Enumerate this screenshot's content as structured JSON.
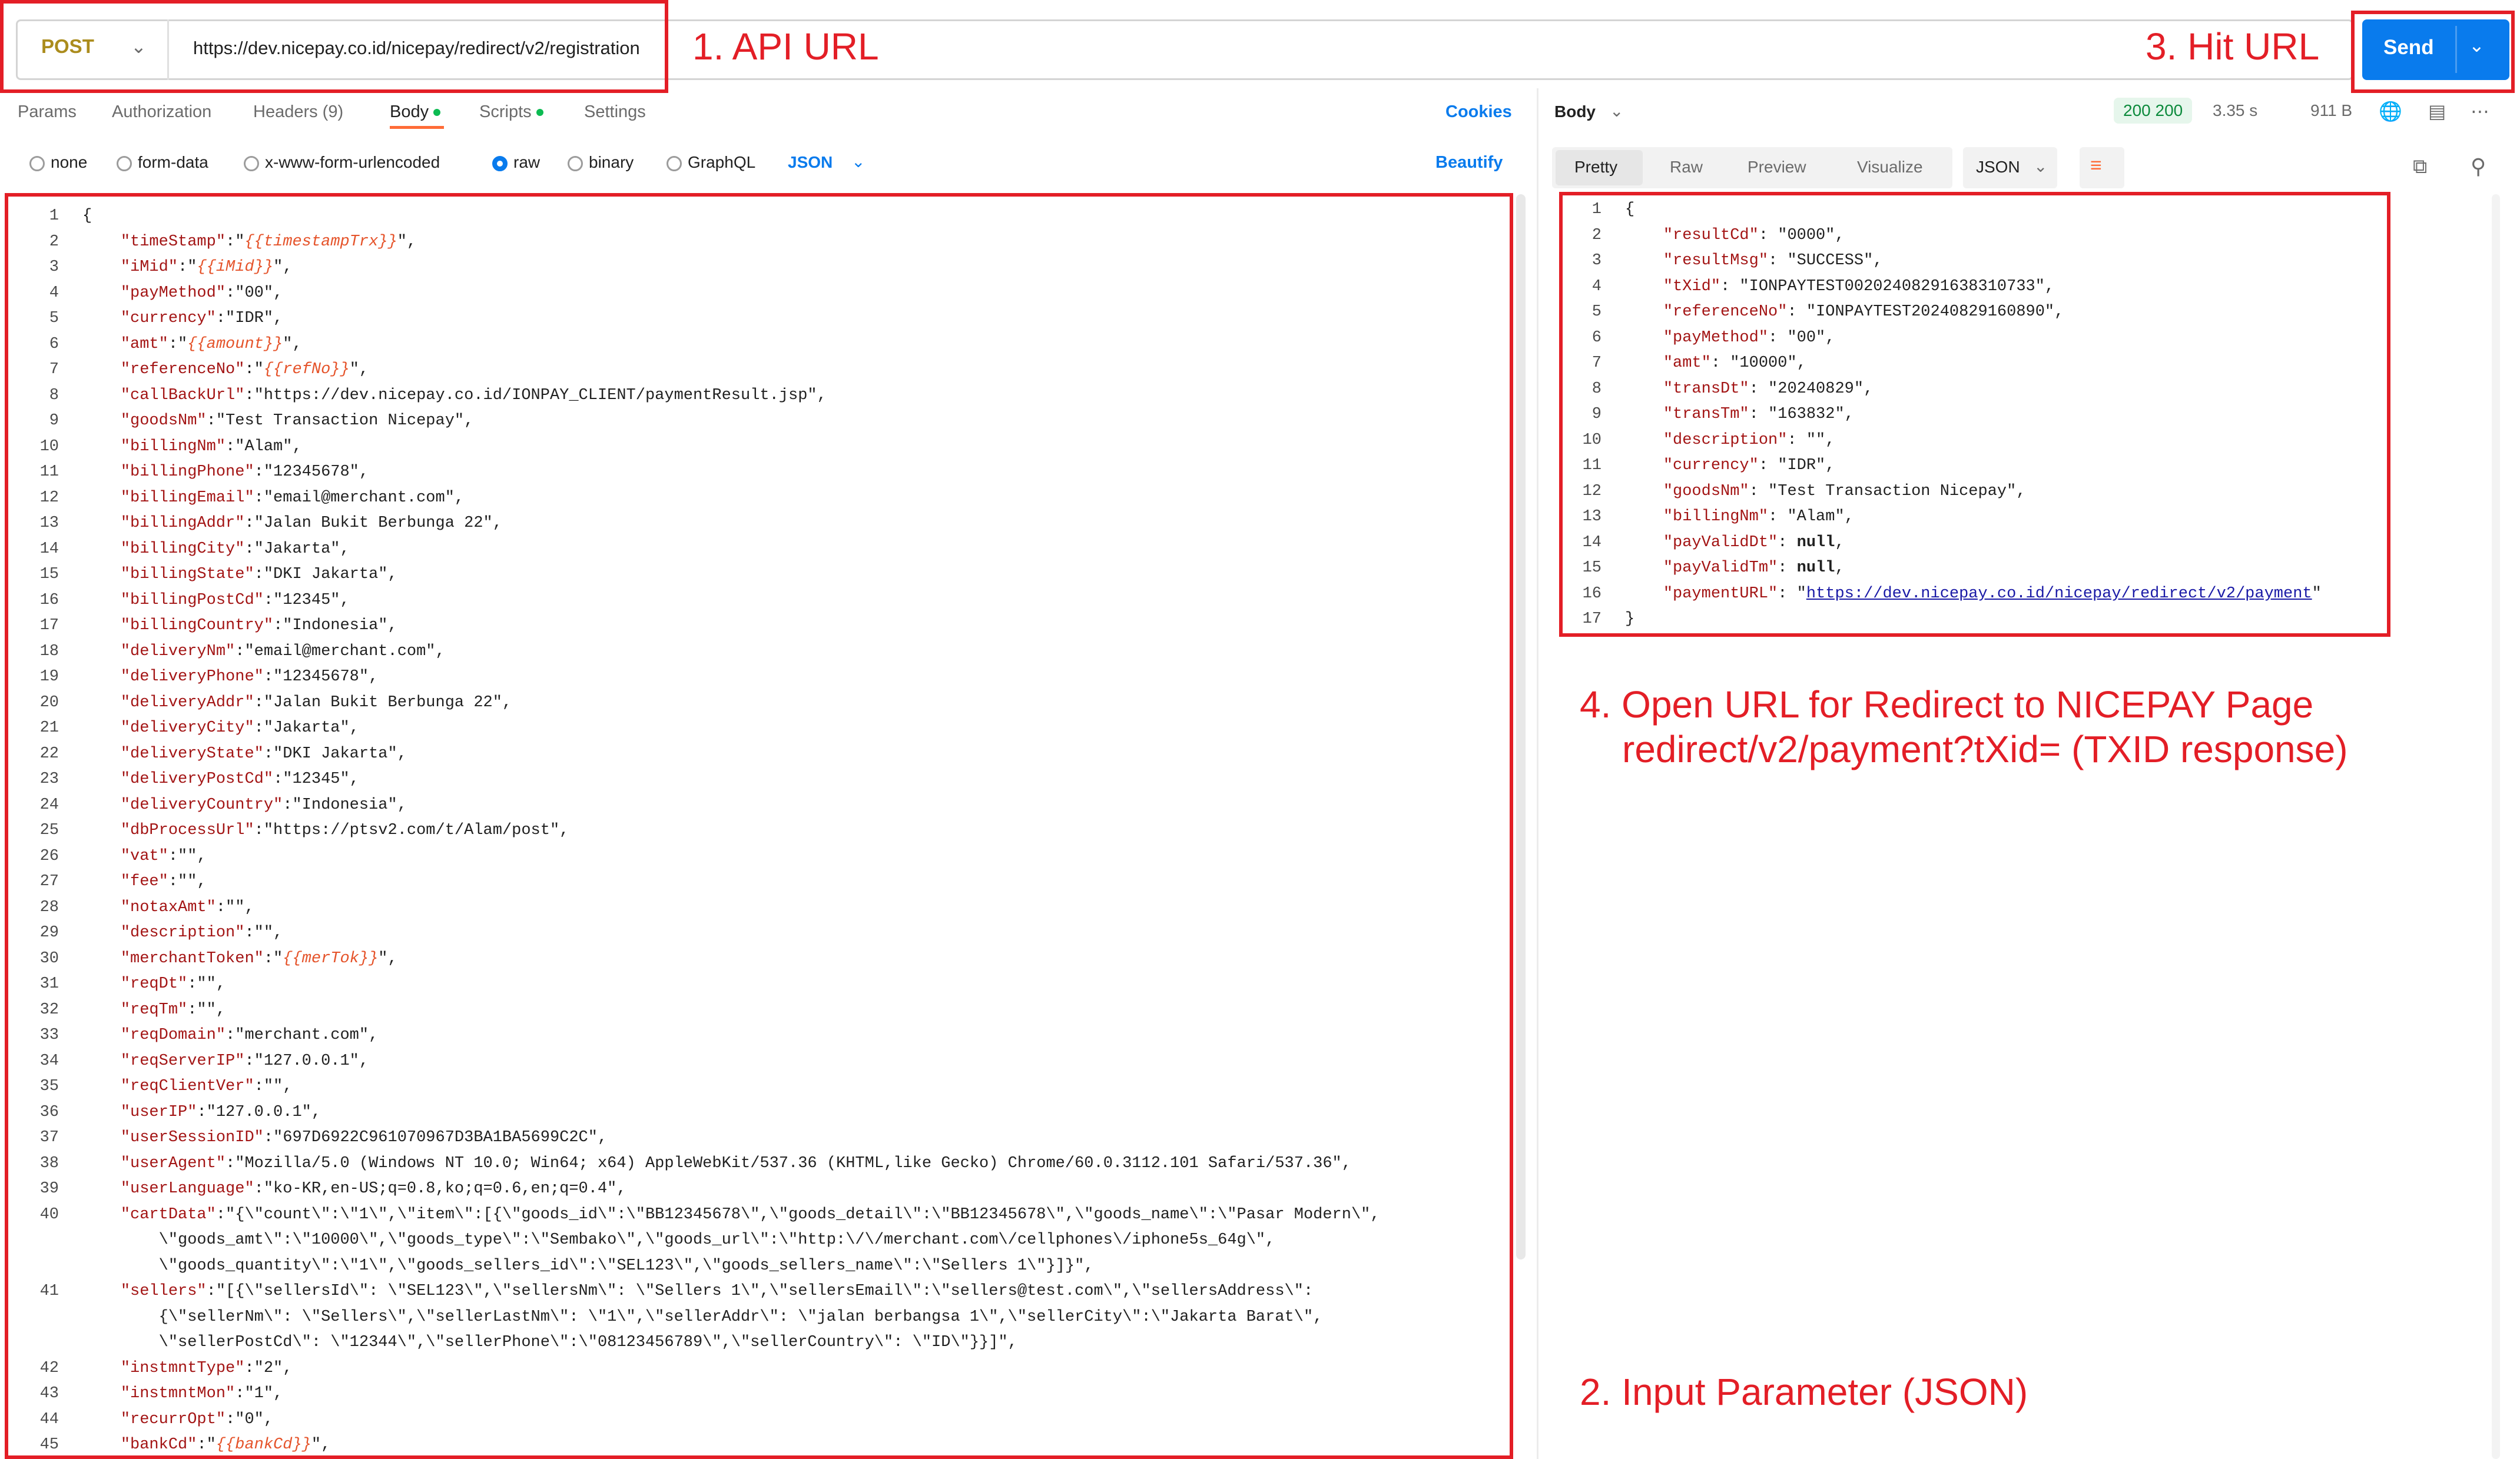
{
  "request": {
    "method": "POST",
    "url": "https://dev.nicepay.co.id/nicepay/redirect/v2/registration",
    "send_label": "Send",
    "tabs": [
      {
        "label": "Params"
      },
      {
        "label": "Authorization"
      },
      {
        "label": "Headers (9)"
      },
      {
        "label": "Body"
      },
      {
        "label": "Scripts"
      },
      {
        "label": "Settings"
      }
    ],
    "cookies_label": "Cookies",
    "body_types": [
      "none",
      "form-data",
      "x-www-form-urlencoded",
      "raw",
      "binary",
      "GraphQL"
    ],
    "selected_body_type": "raw",
    "format": "JSON",
    "beautify_label": "Beautify",
    "lines": [
      "{",
      "    \"timeStamp\":\"{{timestampTrx}}\",",
      "    \"iMid\":\"{{iMid}}\",",
      "    \"payMethod\":\"00\",",
      "    \"currency\":\"IDR\",",
      "    \"amt\":\"{{amount}}\",",
      "    \"referenceNo\":\"{{refNo}}\",",
      "    \"callBackUrl\":\"https://dev.nicepay.co.id/IONPAY_CLIENT/paymentResult.jsp\",",
      "    \"goodsNm\":\"Test Transaction Nicepay\",",
      "    \"billingNm\":\"Alam\",",
      "    \"billingPhone\":\"12345678\",",
      "    \"billingEmail\":\"email@merchant.com\",",
      "    \"billingAddr\":\"Jalan Bukit Berbunga 22\",",
      "    \"billingCity\":\"Jakarta\",",
      "    \"billingState\":\"DKI Jakarta\",",
      "    \"billingPostCd\":\"12345\",",
      "    \"billingCountry\":\"Indonesia\",",
      "    \"deliveryNm\":\"email@merchant.com\",",
      "    \"deliveryPhone\":\"12345678\",",
      "    \"deliveryAddr\":\"Jalan Bukit Berbunga 22\",",
      "    \"deliveryCity\":\"Jakarta\",",
      "    \"deliveryState\":\"DKI Jakarta\",",
      "    \"deliveryPostCd\":\"12345\",",
      "    \"deliveryCountry\":\"Indonesia\",",
      "    \"dbProcessUrl\":\"https://ptsv2.com/t/Alam/post\",",
      "    \"vat\":\"\",",
      "    \"fee\":\"\",",
      "    \"notaxAmt\":\"\",",
      "    \"description\":\"\",",
      "    \"merchantToken\":\"{{merTok}}\",",
      "    \"reqDt\":\"\",",
      "    \"reqTm\":\"\",",
      "    \"reqDomain\":\"merchant.com\",",
      "    \"reqServerIP\":\"127.0.0.1\",",
      "    \"reqClientVer\":\"\",",
      "    \"userIP\":\"127.0.0.1\",",
      "    \"userSessionID\":\"697D6922C961070967D3BA1BA5699C2C\",",
      "    \"userAgent\":\"Mozilla/5.0 (Windows NT 10.0; Win64; x64) AppleWebKit/537.36 (KHTML,like Gecko) Chrome/60.0.3112.101 Safari/537.36\",",
      "    \"userLanguage\":\"ko-KR,en-US;q=0.8,ko;q=0.6,en;q=0.4\",",
      "    \"cartData\":\"{\\\"count\\\":\\\"1\\\",\\\"item\\\":[{\\\"goods_id\\\":\\\"BB12345678\\\",\\\"goods_detail\\\":\\\"BB12345678\\\",\\\"goods_name\\\":\\\"Pasar Modern\\\",",
      "        \\\"goods_amt\\\":\\\"10000\\\",\\\"goods_type\\\":\\\"Sembako\\\",\\\"goods_url\\\":\\\"http:\\/\\/merchant.com\\/cellphones\\/iphone5s_64g\\\",",
      "        \\\"goods_quantity\\\":\\\"1\\\",\\\"goods_sellers_id\\\":\\\"SEL123\\\",\\\"goods_sellers_name\\\":\\\"Sellers 1\\\"}]}\",",
      "    \"sellers\":\"[{\\\"sellersId\\\": \\\"SEL123\\\",\\\"sellersNm\\\": \\\"Sellers 1\\\",\\\"sellersEmail\\\":\\\"sellers@test.com\\\",\\\"sellersAddress\\\":",
      "        {\\\"sellerNm\\\": \\\"Sellers\\\",\\\"sellerLastNm\\\": \\\"1\\\",\\\"sellerAddr\\\": \\\"jalan berbangsa 1\\\",\\\"sellerCity\\\":\\\"Jakarta Barat\\\",",
      "        \\\"sellerPostCd\\\": \\\"12344\\\",\\\"sellerPhone\\\":\\\"08123456789\\\",\\\"sellerCountry\\\": \\\"ID\\\"}}]\",",
      "    \"instmntType\":\"2\",",
      "    \"instmntMon\":\"1\",",
      "    \"recurrOpt\":\"0\",",
      "    \"bankCd\":\"{{bankCd}}\","
    ],
    "line_numbers": [
      "1",
      "2",
      "3",
      "4",
      "5",
      "6",
      "7",
      "8",
      "9",
      "10",
      "11",
      "12",
      "13",
      "14",
      "15",
      "16",
      "17",
      "18",
      "19",
      "20",
      "21",
      "22",
      "23",
      "24",
      "25",
      "26",
      "27",
      "28",
      "29",
      "30",
      "31",
      "32",
      "33",
      "34",
      "35",
      "36",
      "37",
      "38",
      "39",
      "40",
      "",
      "",
      "41",
      "",
      "",
      "42",
      "43",
      "44",
      "45"
    ]
  },
  "response": {
    "body_label": "Body",
    "status": "200 200",
    "time": "3.35 s",
    "size": "911 B",
    "view_tabs": [
      "Pretty",
      "Raw",
      "Preview",
      "Visualize"
    ],
    "format": "JSON",
    "lines": [
      "{",
      "    \"resultCd\": \"0000\",",
      "    \"resultMsg\": \"SUCCESS\",",
      "    \"tXid\": \"IONPAYTEST00202408291638310733\",",
      "    \"referenceNo\": \"IONPAYTEST20240829160890\",",
      "    \"payMethod\": \"00\",",
      "    \"amt\": \"10000\",",
      "    \"transDt\": \"20240829\",",
      "    \"transTm\": \"163832\",",
      "    \"description\": \"\",",
      "    \"currency\": \"IDR\",",
      "    \"goodsNm\": \"Test Transaction Nicepay\",",
      "    \"billingNm\": \"Alam\",",
      "    \"payValidDt\": null,",
      "    \"payValidTm\": null,",
      "    \"paymentURL\": \"https://dev.nicepay.co.id/nicepay/redirect/v2/payment\"",
      "}"
    ]
  },
  "annotations": {
    "step1": "1. API URL",
    "step2": "2. Input Parameter (JSON)",
    "step3": "3. Hit URL",
    "step4_line1": "4. Open URL for Redirect to NICEPAY Page",
    "step4_line2": "redirect/v2/payment?tXid= (TXID response)"
  },
  "colors": {
    "accent_blue": "#097bed",
    "post_method": "#ab8c1d",
    "annotation_red": "#e31e26",
    "status_green": "#0c8a3c",
    "active_tab_orange": "#ff6c37"
  }
}
